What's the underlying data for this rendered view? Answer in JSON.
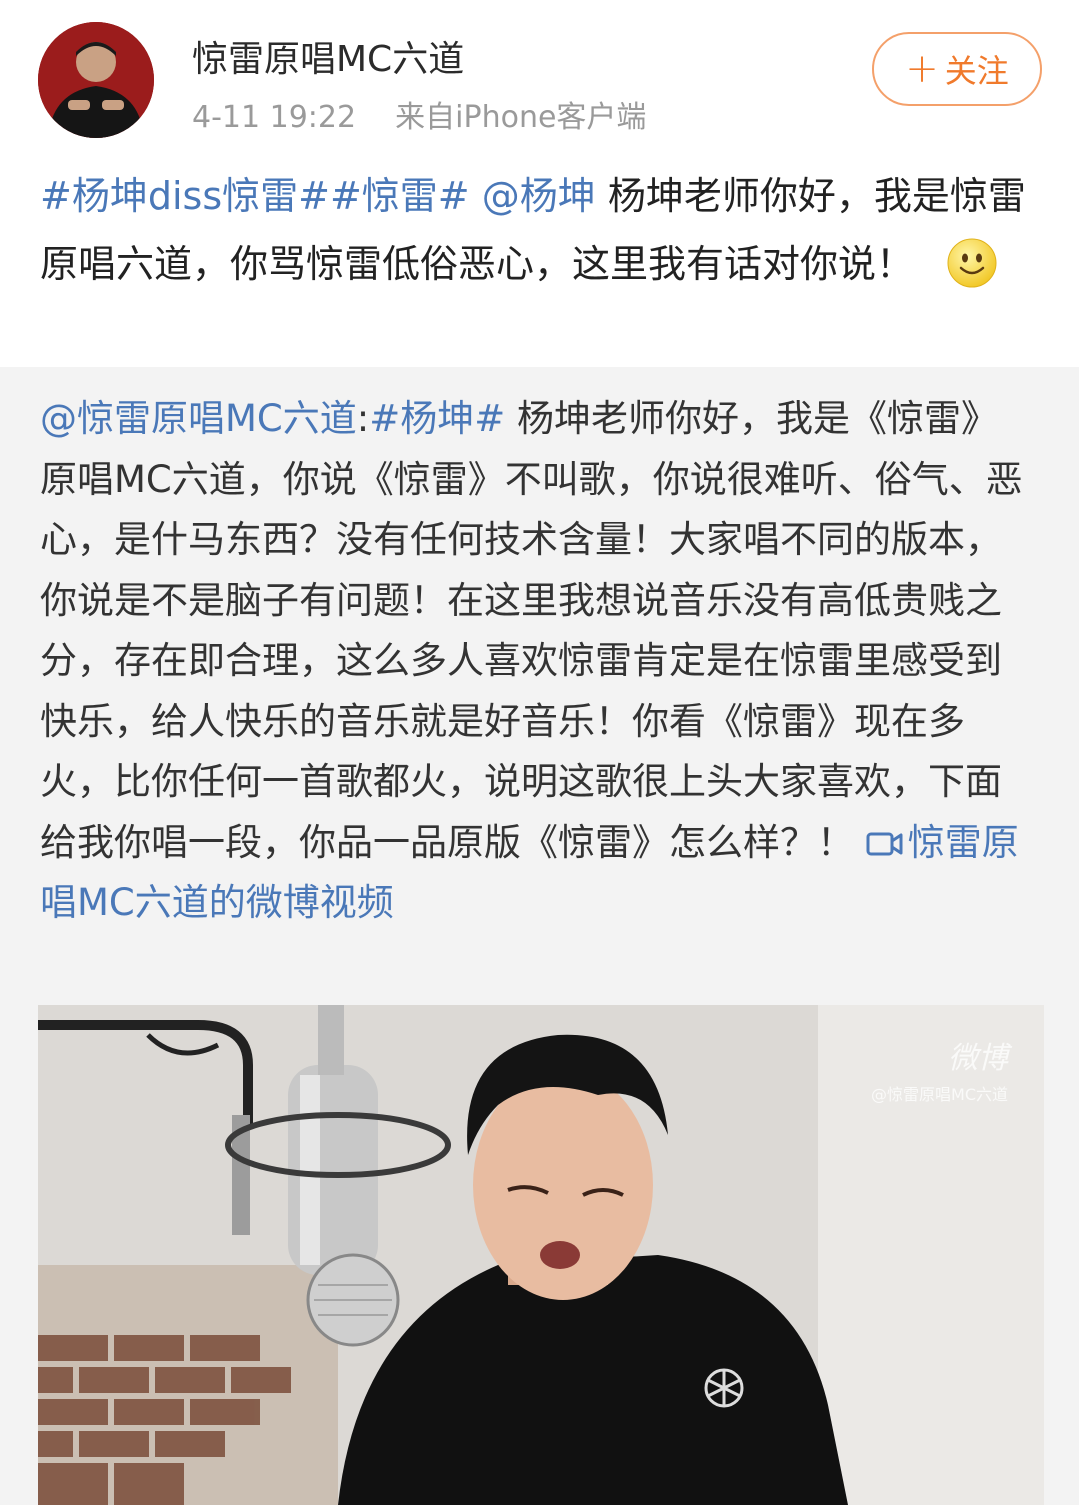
{
  "header": {
    "username": "惊雷原唱MC六道",
    "time": "4-11 19:22",
    "source_prefix": "来自",
    "source": "iPhone客户端",
    "follow_plus": "+",
    "follow_label": "关注"
  },
  "post": {
    "hashtag1": "#杨坤diss惊雷#",
    "hashtag2": "#惊雷#",
    "mention": "@杨坤",
    "text": " 杨坤老师你好，我是惊雷原唱六道，你骂惊雷低俗恶心，这里我有话对你说！",
    "emoji_name": "smile-emoji"
  },
  "repost": {
    "author_mention": "@惊雷原唱MC六道",
    "colon": ":",
    "hashtag": "#杨坤#",
    "text": " 杨坤老师你好，我是《惊雷》原唱MC六道，你说《惊雷》不叫歌，你说很难听、俗气、恶心，是什马东西？没有任何技术含量！大家唱不同的版本，你说是不是脑子有问题！在这里我想说音乐没有高低贵贱之分，存在即合理，这么多人喜欢惊雷肯定是在惊雷里感受到快乐，给人快乐的音乐就是好音乐！你看《惊雷》现在多火，比你任何一首歌都火，说明这歌很上头大家喜欢，下面给我你唱一段，你品一品原版《惊雷》怎么样？！ ",
    "video_link": "惊雷原唱MC六道的微博视频",
    "video_icon": "video-camera-icon"
  },
  "video": {
    "watermark_logo": "微博",
    "watermark_handle": "@惊雷原唱MC六道"
  },
  "colors": {
    "link": "#4a78b8",
    "follow": "#f07a2c",
    "repost_bg": "#f3f3f3"
  }
}
